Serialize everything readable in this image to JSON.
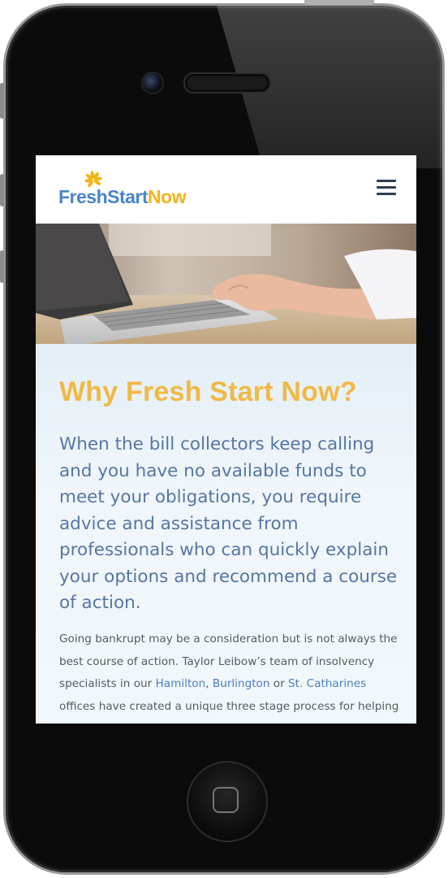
{
  "site": {
    "logo": {
      "fresh_start": "FreshStart",
      "now": "Now"
    }
  },
  "colors": {
    "brand_blue": "#4a84c9",
    "brand_yellow": "#f2b418",
    "headline_gold": "#f0b944",
    "lead_blue": "#5576a4",
    "link_blue": "#4a7fc0"
  },
  "icons": {
    "menu": "hamburger-menu-icon",
    "logo_mark": "sunburst-flower-icon"
  },
  "hero": {
    "image": "laptop-typing-photo"
  },
  "main": {
    "headline": "Why Fresh Start Now?",
    "lead": "When the bill collectors keep calling and you have no available funds to meet your obligations, you require advice and assistance from professionals who can quickly explain your options and recommend a course of action.",
    "body": {
      "part1": "Going bankrupt may be a consideration but is not always the best course of action. Taylor Leibow’s team of insolvency specialists in our ",
      "link_hamilton": "Hamilton",
      "sep1": ", ",
      "link_burlington": "Burlington",
      "sep2": " or ",
      "link_st_catharines": "St. Catharines",
      "part2": " offices have created a unique three stage process for helping"
    }
  }
}
